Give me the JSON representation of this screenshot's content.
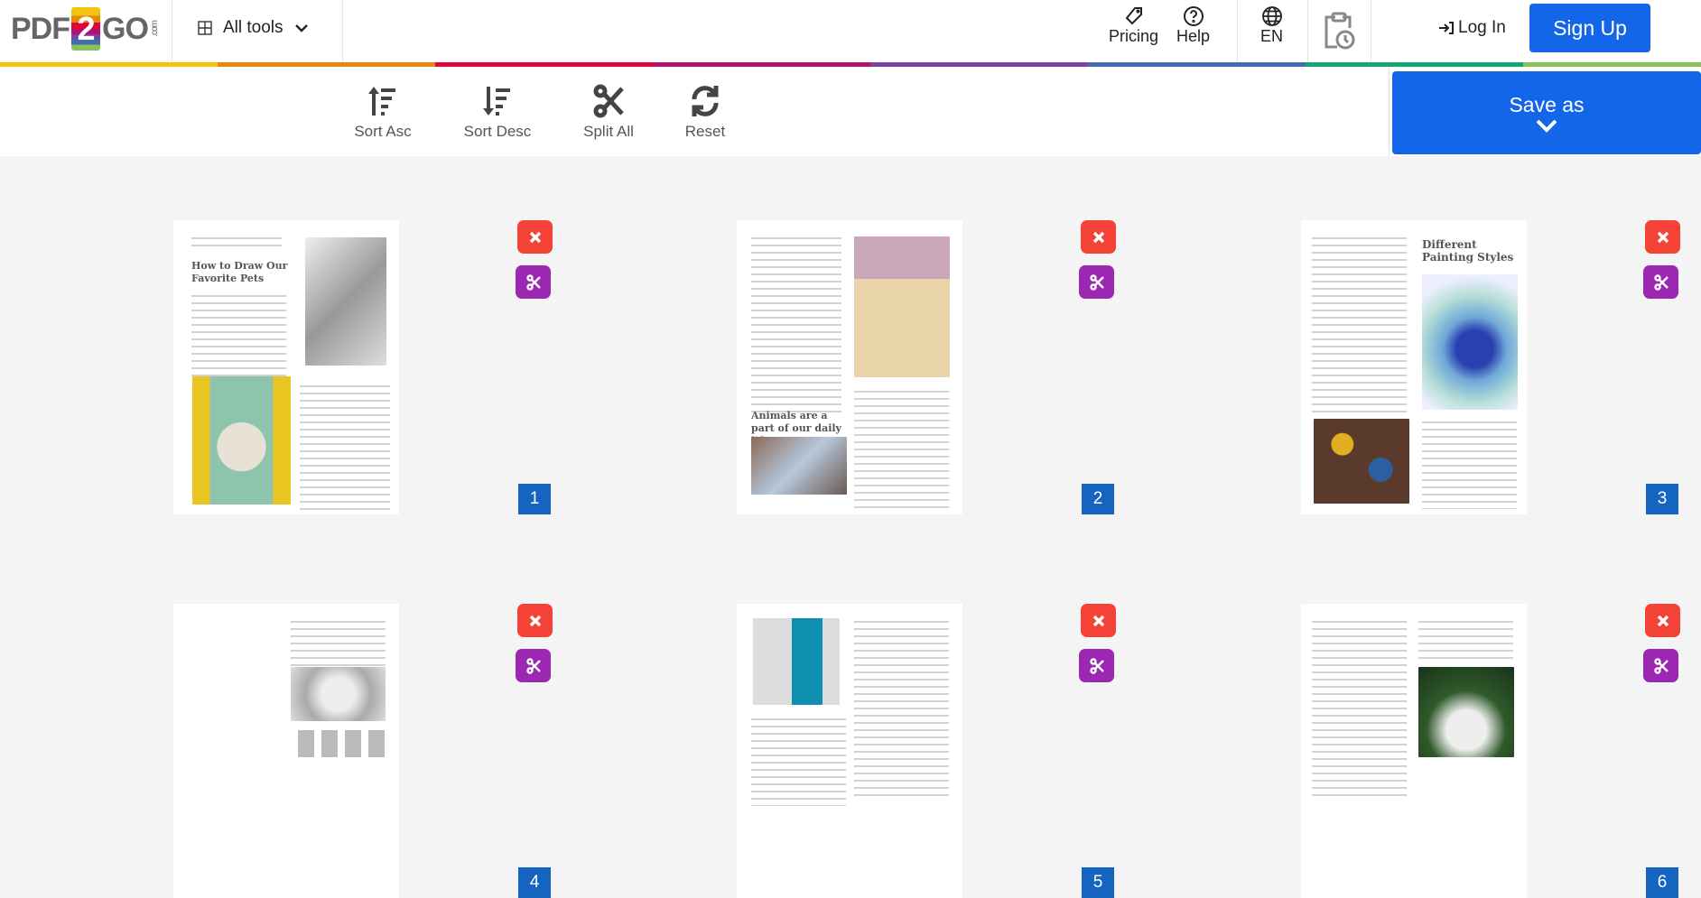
{
  "header": {
    "logo": "PDF2GO.com",
    "logo_parts": {
      "left": "PDF",
      "mid": "2",
      "right": "GO",
      "suffix": ".com"
    },
    "all_tools": "All tools",
    "pricing": "Pricing",
    "help": "Help",
    "language": "EN",
    "login": "Log In",
    "signup": "Sign Up"
  },
  "color_bar": [
    "#f2c40f",
    "#e6890a",
    "#e0063a",
    "#b5106e",
    "#7e3fa0",
    "#3f6db0",
    "#12a57a",
    "#8bc15a"
  ],
  "toolbar": {
    "sort_asc": "Sort Asc",
    "sort_desc": "Sort Desc",
    "split_all": "Split All",
    "reset": "Reset",
    "save_as": "Save as"
  },
  "pages": [
    {
      "number": "1",
      "heading": "How to Draw Our Favorite Pets"
    },
    {
      "number": "2",
      "heading": "Animals are a part of our daily life"
    },
    {
      "number": "3",
      "heading": "Different Painting Styles"
    },
    {
      "number": "4",
      "heading": ""
    },
    {
      "number": "5",
      "heading": ""
    },
    {
      "number": "6",
      "heading": ""
    }
  ]
}
